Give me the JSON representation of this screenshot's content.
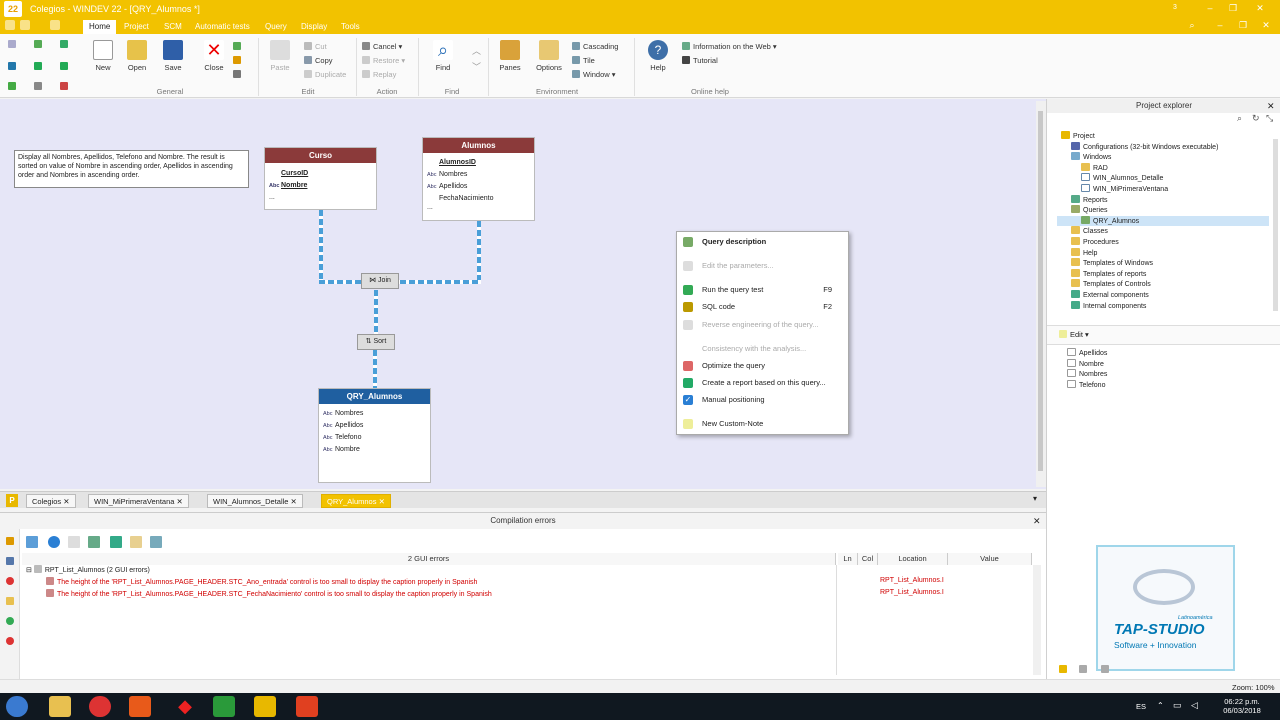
{
  "window": {
    "title": "Colegios - WINDEV 22 - [QRY_Alumnos *]",
    "logo": "22",
    "help_badge": "3"
  },
  "menu": {
    "tabs": [
      "Home",
      "Project",
      "SCM",
      "Automatic tests",
      "Query",
      "Display",
      "Tools"
    ],
    "active": "Home"
  },
  "ribbon": {
    "general": {
      "label": "General",
      "new": "New",
      "open": "Open",
      "save": "Save",
      "close": "Close"
    },
    "edit": {
      "label": "Edit",
      "paste": "Paste",
      "cut": "Cut",
      "copy": "Copy",
      "duplicate": "Duplicate"
    },
    "action": {
      "label": "Action",
      "cancel": "Cancel",
      "restore": "Restore",
      "replay": "Replay"
    },
    "find": {
      "label": "Find",
      "find": "Find"
    },
    "environment": {
      "label": "Environment",
      "panes": "Panes",
      "options": "Options",
      "cascading": "Cascading",
      "tile": "Tile",
      "window": "Window"
    },
    "online_help": {
      "label": "Online help",
      "help": "Help",
      "info_web": "Information on the Web",
      "tutorial": "Tutorial"
    }
  },
  "editor": {
    "note": "Display all Nombres, Apellidos, Telefono and Nombre. The result is sorted on value of Nombre in ascending order, Apellidos in ascending order and Nombres in ascending order.",
    "curso": {
      "title": "Curso",
      "fields": [
        {
          "type": "",
          "name": "CursoID"
        },
        {
          "type": "Abc",
          "name": "Nombre"
        }
      ],
      "more": "..."
    },
    "alumnos": {
      "title": "Alumnos",
      "fields": [
        {
          "type": "",
          "name": "AlumnosID"
        },
        {
          "type": "Abc",
          "name": "Nombres"
        },
        {
          "type": "Abc",
          "name": "Apellidos"
        },
        {
          "type": "",
          "name": "FechaNacimiento"
        }
      ],
      "more": "..."
    },
    "join": "Join",
    "sort": "Sort",
    "result": {
      "title": "QRY_Alumnos",
      "fields": [
        {
          "type": "Abc",
          "name": "Nombres"
        },
        {
          "type": "Abc",
          "name": "Apellidos"
        },
        {
          "type": "Abc",
          "name": "Telefono"
        },
        {
          "type": "Abc",
          "name": "Nombre"
        }
      ]
    }
  },
  "context_menu": {
    "items": [
      {
        "label": "Query description",
        "shortcut": "",
        "disabled": false,
        "bold": true
      },
      {
        "label": "Edit the parameters...",
        "shortcut": "",
        "disabled": true
      },
      {
        "label": "Run the query test",
        "shortcut": "F9",
        "disabled": false
      },
      {
        "label": "SQL code",
        "shortcut": "F2",
        "disabled": false
      },
      {
        "label": "Reverse engineering of the query...",
        "shortcut": "",
        "disabled": true
      },
      {
        "label": "Consistency with the analysis...",
        "shortcut": "",
        "disabled": true
      },
      {
        "label": "Optimize the query",
        "shortcut": "",
        "disabled": false
      },
      {
        "label": "Create a report based on this query...",
        "shortcut": "",
        "disabled": false
      },
      {
        "label": "Manual positioning",
        "shortcut": "",
        "disabled": false,
        "checked": true
      },
      {
        "label": "New Custom-Note",
        "shortcut": "",
        "disabled": false
      }
    ],
    "check_mark": "✓"
  },
  "project_explorer": {
    "title": "Project explorer",
    "tree": [
      {
        "label": "Project",
        "level": 0
      },
      {
        "label": "Configurations (32-bit Windows executable)",
        "level": 1
      },
      {
        "label": "Windows",
        "level": 1
      },
      {
        "label": "RAD",
        "level": 2
      },
      {
        "label": "WIN_Alumnos_Detalle",
        "level": 2
      },
      {
        "label": "WIN_MiPrimeraVentana",
        "level": 2
      },
      {
        "label": "Reports",
        "level": 1
      },
      {
        "label": "Queries",
        "level": 1
      },
      {
        "label": "QRY_Alumnos",
        "level": 2
      },
      {
        "label": "Classes",
        "level": 1
      },
      {
        "label": "Procedures",
        "level": 1
      },
      {
        "label": "Help",
        "level": 1
      },
      {
        "label": "Templates of Windows",
        "level": 1
      },
      {
        "label": "Templates of reports",
        "level": 1
      },
      {
        "label": "Templates of Controls",
        "level": 1
      },
      {
        "label": "External components",
        "level": 1
      },
      {
        "label": "Internal components",
        "level": 1
      }
    ],
    "edit_label": "Edit",
    "fields": [
      "Apellidos",
      "Nombre",
      "Nombres",
      "Telefono"
    ]
  },
  "doc_tabs": [
    "Colegios",
    "WIN_MiPrimeraVentana",
    "WIN_Alumnos_Detalle",
    "QRY_Alumnos"
  ],
  "errors": {
    "title": "Compilation errors",
    "summary": "2 GUI errors",
    "col_ln": "Ln",
    "col_col": "Col",
    "col_location": "Location",
    "col_value": "Value",
    "group": "RPT_List_Alumnos (2 GUI errors)",
    "rows": [
      {
        "msg": "The height of the 'RPT_List_Alumnos.PAGE_HEADER.STC_Ano_entrada' control is too small to display the caption properly in Spanish",
        "loc": "RPT_List_Alumnos.I"
      },
      {
        "msg": "The height of the 'RPT_List_Alumnos.PAGE_HEADER.STC_FechaNacimiento' control is too small to display the caption properly in Spanish",
        "loc": "RPT_List_Alumnos.I"
      }
    ]
  },
  "watermark": {
    "brand": "TAP-STUDIO",
    "sub": "Software + Innovation",
    "tag": "Latinoamérica"
  },
  "status": {
    "zoom": "Zoom: 100%"
  },
  "taskbar": {
    "lang": "ES",
    "time": "06:22 p.m.",
    "date": "06/03/2018"
  }
}
